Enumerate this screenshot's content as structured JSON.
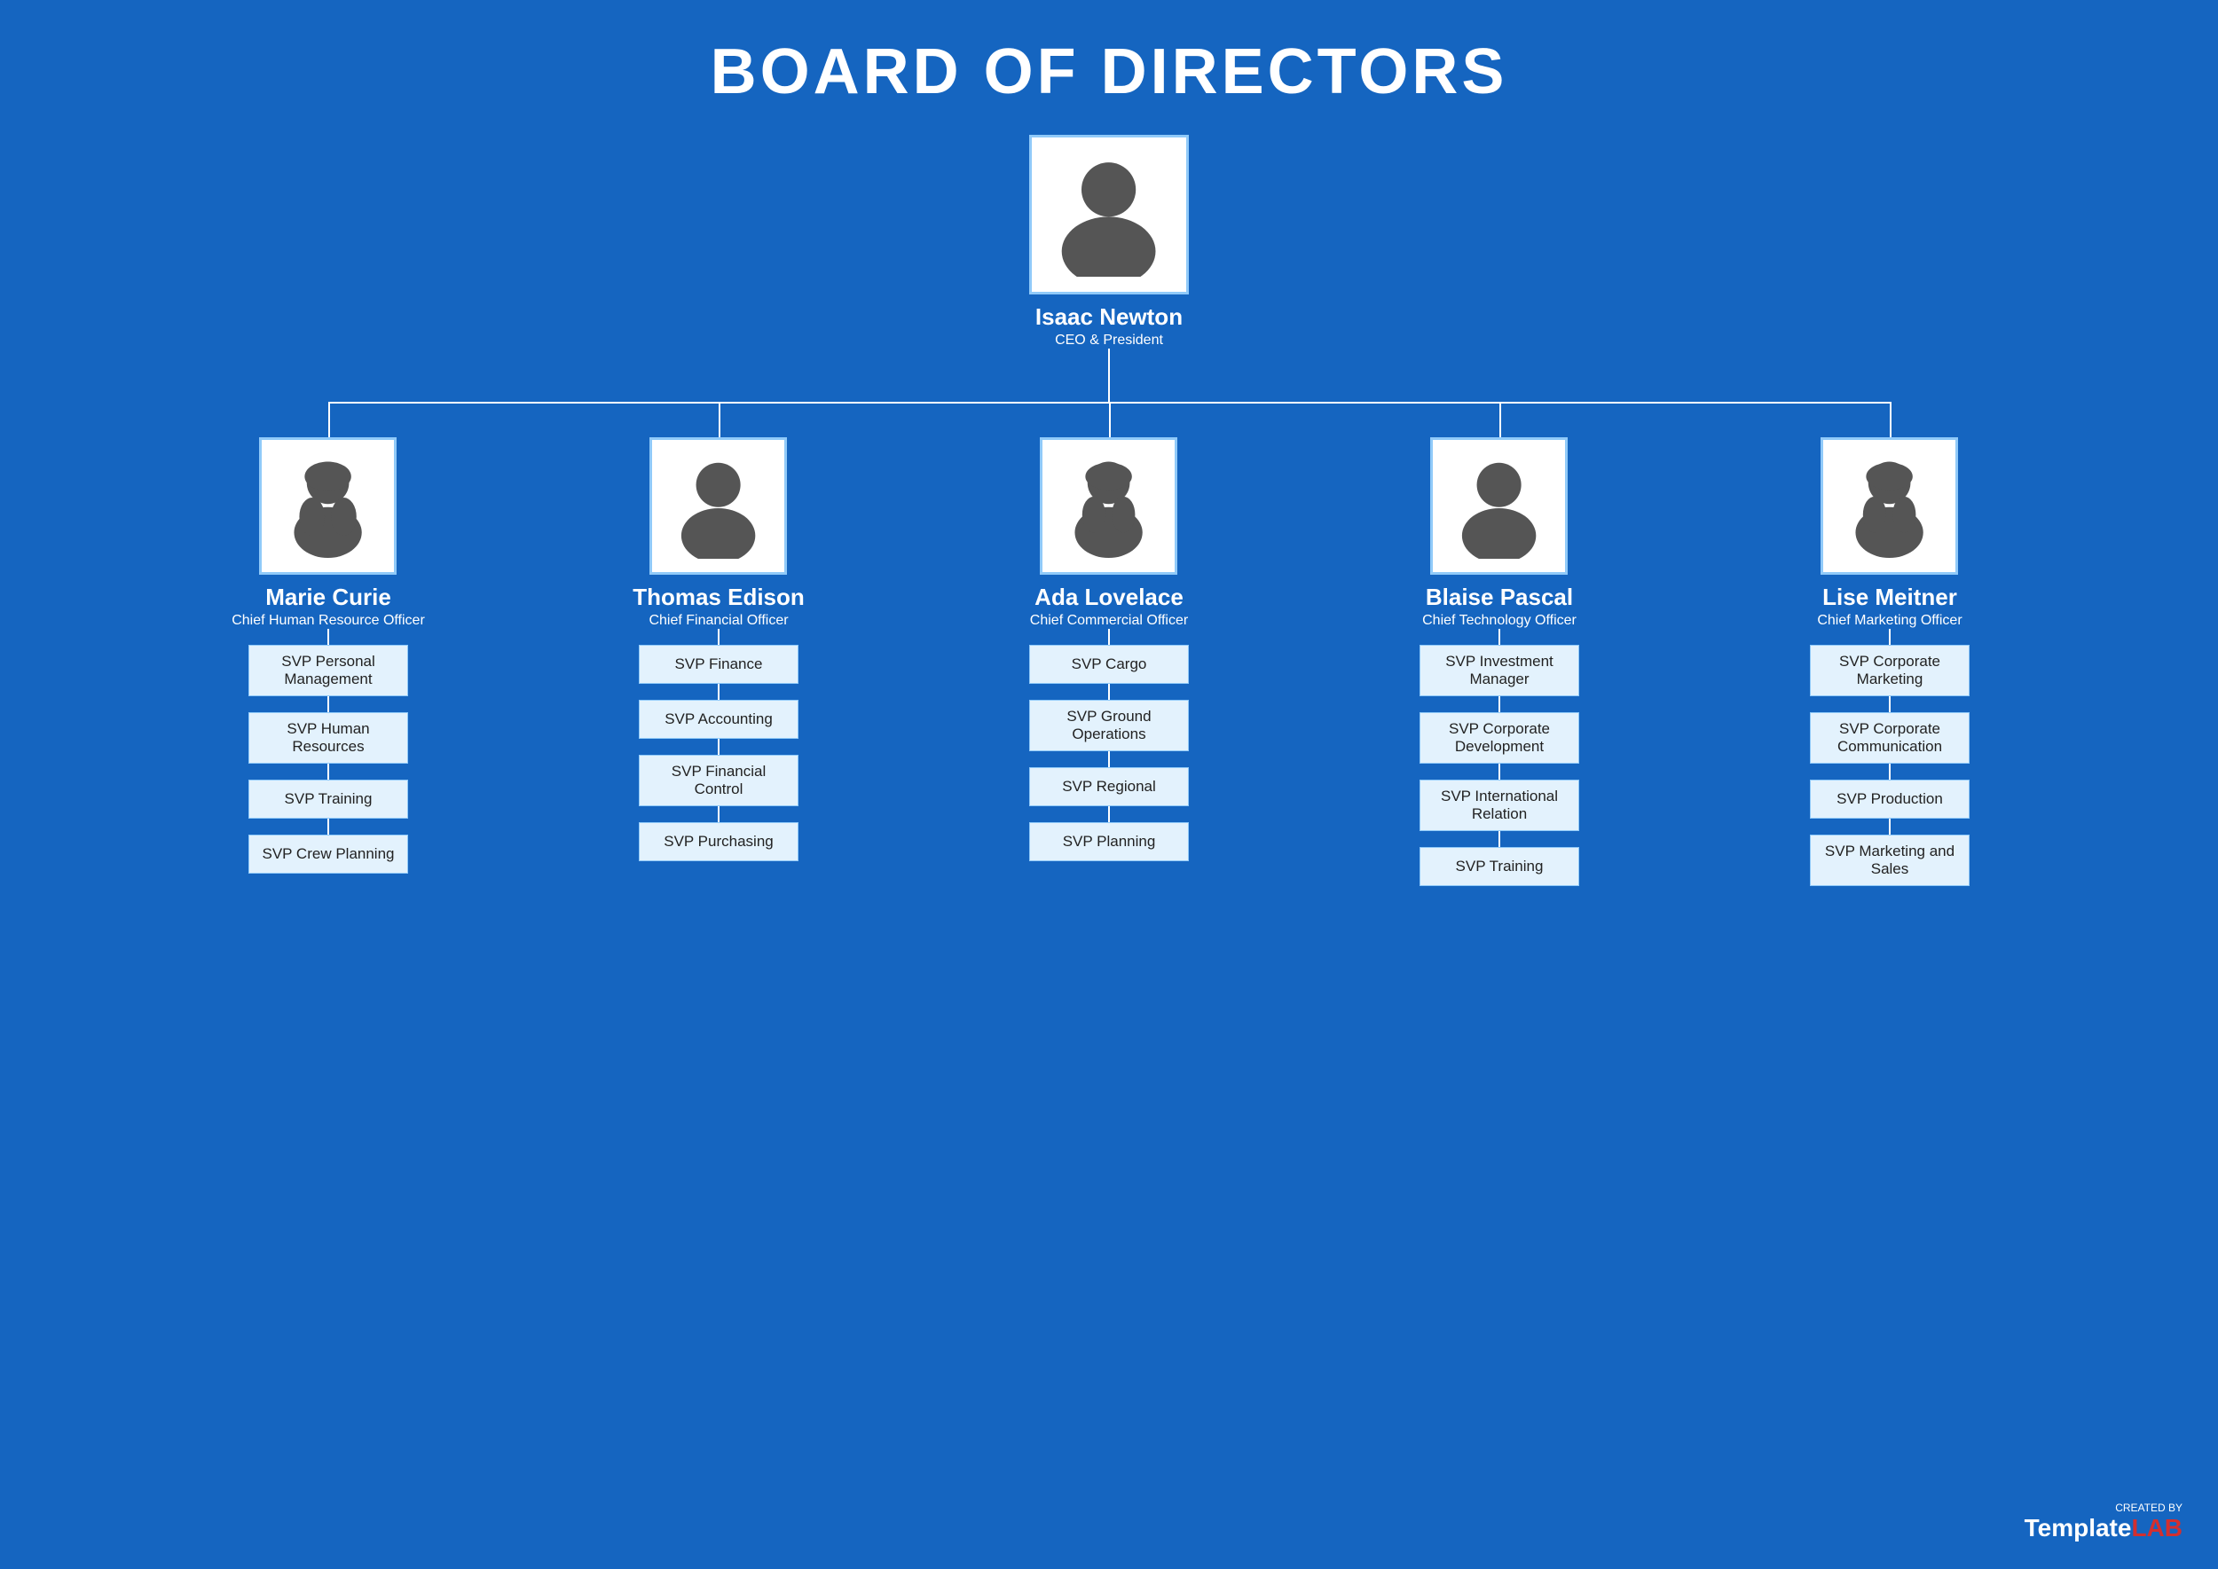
{
  "page": {
    "title": "BOARD OF DIRECTORS",
    "background_color": "#1565C0"
  },
  "ceo": {
    "name": "Isaac Newton",
    "title": "CEO & President"
  },
  "columns": [
    {
      "name": "Marie Curie",
      "title": "Chief Human Resource Officer",
      "svps": [
        "SVP Personal Management",
        "SVP Human Resources",
        "SVP Training",
        "SVP Crew Planning"
      ]
    },
    {
      "name": "Thomas Edison",
      "title": "Chief Financial Officer",
      "svps": [
        "SVP Finance",
        "SVP Accounting",
        "SVP Financial Control",
        "SVP Purchasing"
      ]
    },
    {
      "name": "Ada Lovelace",
      "title": "Chief Commercial Officer",
      "svps": [
        "SVP Cargo",
        "SVP Ground Operations",
        "SVP Regional",
        "SVP Planning"
      ]
    },
    {
      "name": "Blaise Pascal",
      "title": "Chief Technology Officer",
      "svps": [
        "SVP Investment Manager",
        "SVP Corporate Development",
        "SVP International Relation",
        "SVP Training"
      ]
    },
    {
      "name": "Lise Meitner",
      "title": "Chief Marketing Officer",
      "svps": [
        "SVP Corporate Marketing",
        "SVP Corporate Communication",
        "SVP Production",
        "SVP Marketing and Sales"
      ]
    }
  ],
  "watermark": {
    "created_by": "CREATED BY",
    "brand_template": "Template",
    "brand_lab": "LAB"
  }
}
